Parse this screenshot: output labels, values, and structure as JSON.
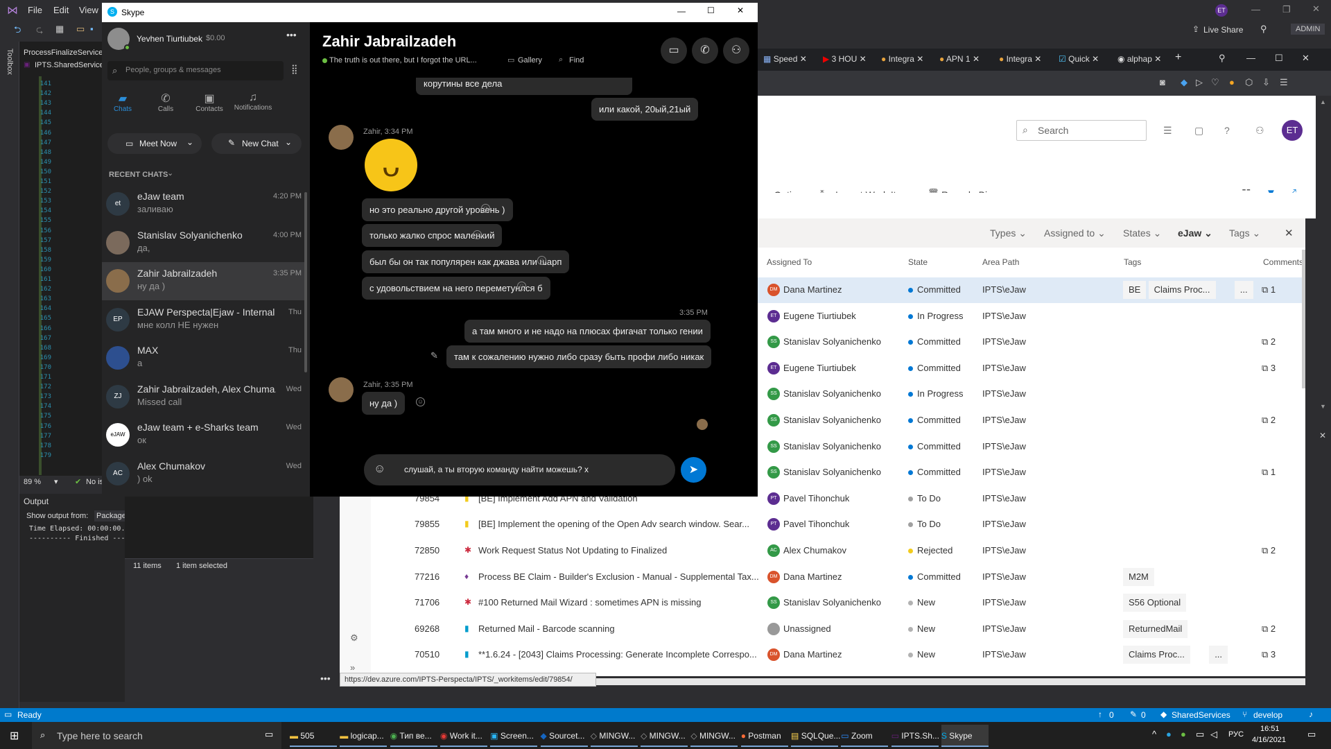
{
  "vs": {
    "menu": [
      "File",
      "Edit",
      "View"
    ],
    "toolbox_label": "Toolbox",
    "editor_tabs": [
      "ProcessFinalizeService.",
      "IPTS.SharedServices"
    ],
    "line_numbers": [
      "141",
      "142",
      "143",
      "144",
      "145",
      "146",
      "147",
      "148",
      "149",
      "150",
      "151",
      "152",
      "153",
      "154",
      "155",
      "156",
      "157",
      "158",
      "159",
      "160",
      "161",
      "162",
      "163",
      "164",
      "165",
      "166",
      "167",
      "168",
      "169",
      "170",
      "171",
      "172",
      "173",
      "174",
      "175",
      "176",
      "177",
      "178",
      "179"
    ],
    "zoom": "89 %",
    "no_issues": "No is",
    "output_title": "Output",
    "output_from_label": "Show output from:",
    "output_from_value": "Package",
    "output_lines": [
      "Time Elapsed: 00:00:00.",
      "---------- Finished ---"
    ],
    "items_status": "11 items",
    "selected_status": "1 item selected",
    "live_share": "Live Share",
    "admin": "ADMIN",
    "user_badge": "ET"
  },
  "statusbar": {
    "ready": "Ready",
    "up_count": "0",
    "pencil_count": "0",
    "repo": "SharedServices",
    "branch": "develop"
  },
  "browser": {
    "tabs": [
      "Speed",
      "3 HOU",
      "Integra",
      "APN 1",
      "Integra",
      "Quick",
      "alphap"
    ],
    "new_tab": "+"
  },
  "ado": {
    "search_placeholder": "Search",
    "user_initials": "ET",
    "toolbar": {
      "column_options": "mn Options",
      "import": "Import Work Items",
      "recycle": "Recycle Bin"
    },
    "filters": [
      "Types",
      "Assigned to",
      "States",
      "eJaw",
      "Tags"
    ],
    "columns": {
      "assigned": "Assigned To",
      "state": "State",
      "area": "Area Path",
      "tags": "Tags",
      "comments": "Comments"
    },
    "rows": [
      {
        "id": "",
        "title": "",
        "assigned": "Dana Martinez",
        "initials": "DM",
        "avcolor": "#d9532c",
        "state": "Committed",
        "statecolor": "#0078d4",
        "area": "IPTS\\eJaw",
        "tags": [
          "BE",
          "Claims Proc...",
          "..."
        ],
        "comments": "1",
        "selected": true,
        "type": ""
      },
      {
        "id": "",
        "title": "",
        "assigned": "Eugene Tiurtiubek",
        "initials": "ET",
        "avcolor": "#5c2d91",
        "state": "In Progress",
        "statecolor": "#0078d4",
        "area": "IPTS\\eJaw",
        "tags": [],
        "comments": "",
        "type": ""
      },
      {
        "id": "",
        "title": "",
        "assigned": "Stanislav Solyanichenko",
        "initials": "SS",
        "avcolor": "#339947",
        "state": "Committed",
        "statecolor": "#0078d4",
        "area": "IPTS\\eJaw",
        "tags": [],
        "comments": "2",
        "type": ""
      },
      {
        "id": "",
        "title": "",
        "assigned": "Eugene Tiurtiubek",
        "initials": "ET",
        "avcolor": "#5c2d91",
        "state": "Committed",
        "statecolor": "#0078d4",
        "area": "IPTS\\eJaw",
        "tags": [],
        "comments": "3",
        "type": ""
      },
      {
        "id": "",
        "title": "",
        "assigned": "Stanislav Solyanichenko",
        "initials": "SS",
        "avcolor": "#339947",
        "state": "In Progress",
        "statecolor": "#0078d4",
        "area": "IPTS\\eJaw",
        "tags": [],
        "comments": "",
        "type": ""
      },
      {
        "id": "",
        "title": "",
        "assigned": "Stanislav Solyanichenko",
        "initials": "SS",
        "avcolor": "#339947",
        "state": "Committed",
        "statecolor": "#0078d4",
        "area": "IPTS\\eJaw",
        "tags": [],
        "comments": "2",
        "type": ""
      },
      {
        "id": "",
        "title": "",
        "assigned": "Stanislav Solyanichenko",
        "initials": "SS",
        "avcolor": "#339947",
        "state": "Committed",
        "statecolor": "#0078d4",
        "area": "IPTS\\eJaw",
        "tags": [],
        "comments": "",
        "type": ""
      },
      {
        "id": "",
        "title": "",
        "assigned": "Stanislav Solyanichenko",
        "initials": "SS",
        "avcolor": "#339947",
        "state": "Committed",
        "statecolor": "#0078d4",
        "area": "IPTS\\eJaw",
        "tags": [],
        "comments": "1",
        "type": ""
      },
      {
        "id": "79854",
        "title": "[BE] Implement Add APN and Validation",
        "assigned": "Pavel Tihonchuk",
        "initials": "PT",
        "avcolor": "#5c2d91",
        "state": "To Do",
        "statecolor": "#a0a0a0",
        "area": "IPTS\\eJaw",
        "tags": [],
        "comments": "",
        "type": "task"
      },
      {
        "id": "79855",
        "title": "[BE] Implement the opening of the Open Adv search window. Sear...",
        "assigned": "Pavel Tihonchuk",
        "initials": "PT",
        "avcolor": "#5c2d91",
        "state": "To Do",
        "statecolor": "#a0a0a0",
        "area": "IPTS\\eJaw",
        "tags": [],
        "comments": "",
        "type": "task"
      },
      {
        "id": "72850",
        "title": "Work Request Status Not Updating to Finalized",
        "assigned": "Alex Chumakov",
        "initials": "AC",
        "avcolor": "#339947",
        "state": "Rejected",
        "statecolor": "#f2cb1d",
        "area": "IPTS\\eJaw",
        "tags": [],
        "comments": "2",
        "type": "bug"
      },
      {
        "id": "77216",
        "title": "Process BE Claim - Builder's Exclusion - Manual - Supplemental Tax...",
        "assigned": "Dana Martinez",
        "initials": "DM",
        "avcolor": "#d9532c",
        "state": "Committed",
        "statecolor": "#0078d4",
        "area": "IPTS\\eJaw",
        "tags": [
          "M2M"
        ],
        "comments": "",
        "type": "feature"
      },
      {
        "id": "71706",
        "title": "#100 Returned Mail Wizard : sometimes APN is missing",
        "assigned": "Stanislav Solyanichenko",
        "initials": "SS",
        "avcolor": "#339947",
        "state": "New",
        "statecolor": "#b2b2b2",
        "area": "IPTS\\eJaw",
        "tags": [
          "S56 Optional"
        ],
        "comments": "",
        "type": "bug"
      },
      {
        "id": "69268",
        "title": "Returned Mail - Barcode scanning",
        "assigned": "Unassigned",
        "initials": "",
        "avcolor": "#999999",
        "state": "New",
        "statecolor": "#b2b2b2",
        "area": "IPTS\\eJaw",
        "tags": [
          "ReturnedMail"
        ],
        "comments": "2",
        "type": "story"
      },
      {
        "id": "70510",
        "title": "**1.6.24 - [2043] Claims Processing: Generate Incomplete Correspo...",
        "assigned": "Dana Martinez",
        "initials": "DM",
        "avcolor": "#d9532c",
        "state": "New",
        "statecolor": "#b2b2b2",
        "area": "IPTS\\eJaw",
        "tags": [
          "Claims Proc...",
          "..."
        ],
        "comments": "3",
        "type": "story"
      }
    ],
    "status_url": "https://dev.azure.com/IPTS-Perspecta/IPTS/_workitems/edit/79854/"
  },
  "skype": {
    "window_title": "Skype",
    "profile": {
      "name": "Yevhen Tiurtiubek",
      "balance": "$0.00"
    },
    "search_placeholder": "People, groups & messages",
    "nav": [
      "Chats",
      "Calls",
      "Contacts",
      "Notifications"
    ],
    "meet_now": "Meet Now",
    "new_chat": "New Chat",
    "recent_label": "RECENT CHATS",
    "chats": [
      {
        "name": "eJaw team",
        "preview": "заливаю",
        "time": "4:20 PM",
        "av": "et",
        "avcolor": "#2e3a44"
      },
      {
        "name": "Stanislav Solyanichenko",
        "preview": "да,",
        "time": "4:00 PM",
        "av": "",
        "avcolor": "#7b6a5c"
      },
      {
        "name": "Zahir Jabrailzadeh",
        "preview": "ну да )",
        "time": "3:35 PM",
        "av": "",
        "avcolor": "#8a6d4b",
        "selected": true
      },
      {
        "name": "EJAW Perspecta|Ejaw - Internal",
        "preview": "мне колл НЕ нужен",
        "time": "Thu",
        "av": "EP",
        "avcolor": "#2e3a44"
      },
      {
        "name": "MAX",
        "preview": "а",
        "time": "Thu",
        "av": "",
        "avcolor": "#2d4f8f"
      },
      {
        "name": "Zahir Jabrailzadeh, Alex Chuma...",
        "preview": "Missed call",
        "time": "Wed",
        "av": "ZJ",
        "avcolor": "#2e3a44"
      },
      {
        "name": "eJaw team + e-Sharks team",
        "preview": "ок",
        "time": "Wed",
        "av": "eJAW",
        "avcolor": "#ffffff"
      },
      {
        "name": "Alex Chumakov",
        "preview": ") ok",
        "time": "Wed",
        "av": "AC",
        "avcolor": "#2e3a44"
      }
    ],
    "conversation": {
      "name": "Zahir Jabrailzadeh",
      "mood": "The truth is out there, but I forgot the URL...",
      "gallery": "Gallery",
      "find": "Find",
      "msg_top_partial": "корутины все дела",
      "msg_out_1": "или какой, 20ый,21ый",
      "sender_1": "Zahir, 3:34 PM",
      "in_msgs": [
        "но это реально другой уровень )",
        "только жалко спрос маленкий",
        "был бы он так популярен как джава или шарп",
        "с удовольствием на него переметунлся б"
      ],
      "out_time": "3:35 PM",
      "out_msgs": [
        "а там много и не надо на плюсах фигачат только гении",
        "там к сожалению нужно либо сразу быть профи либо никак"
      ],
      "sender_2": "Zahir, 3:35 PM",
      "in_last": "ну да )",
      "compose_value": "слушай, а ты вторую команду найти можешь? х"
    }
  },
  "taskbar": {
    "search_placeholder": "Type here to search",
    "items": [
      "505",
      "logicap...",
      "Тип ве...",
      "Work it...",
      "Screen...",
      "Sourcet...",
      "MINGW...",
      "MINGW...",
      "MINGW...",
      "Postman",
      "SQLQue...",
      "Zoom",
      "IPTS.Sh...",
      "Skype"
    ],
    "lang": "РУС",
    "time": "16:51",
    "date": "4/16/2021"
  }
}
